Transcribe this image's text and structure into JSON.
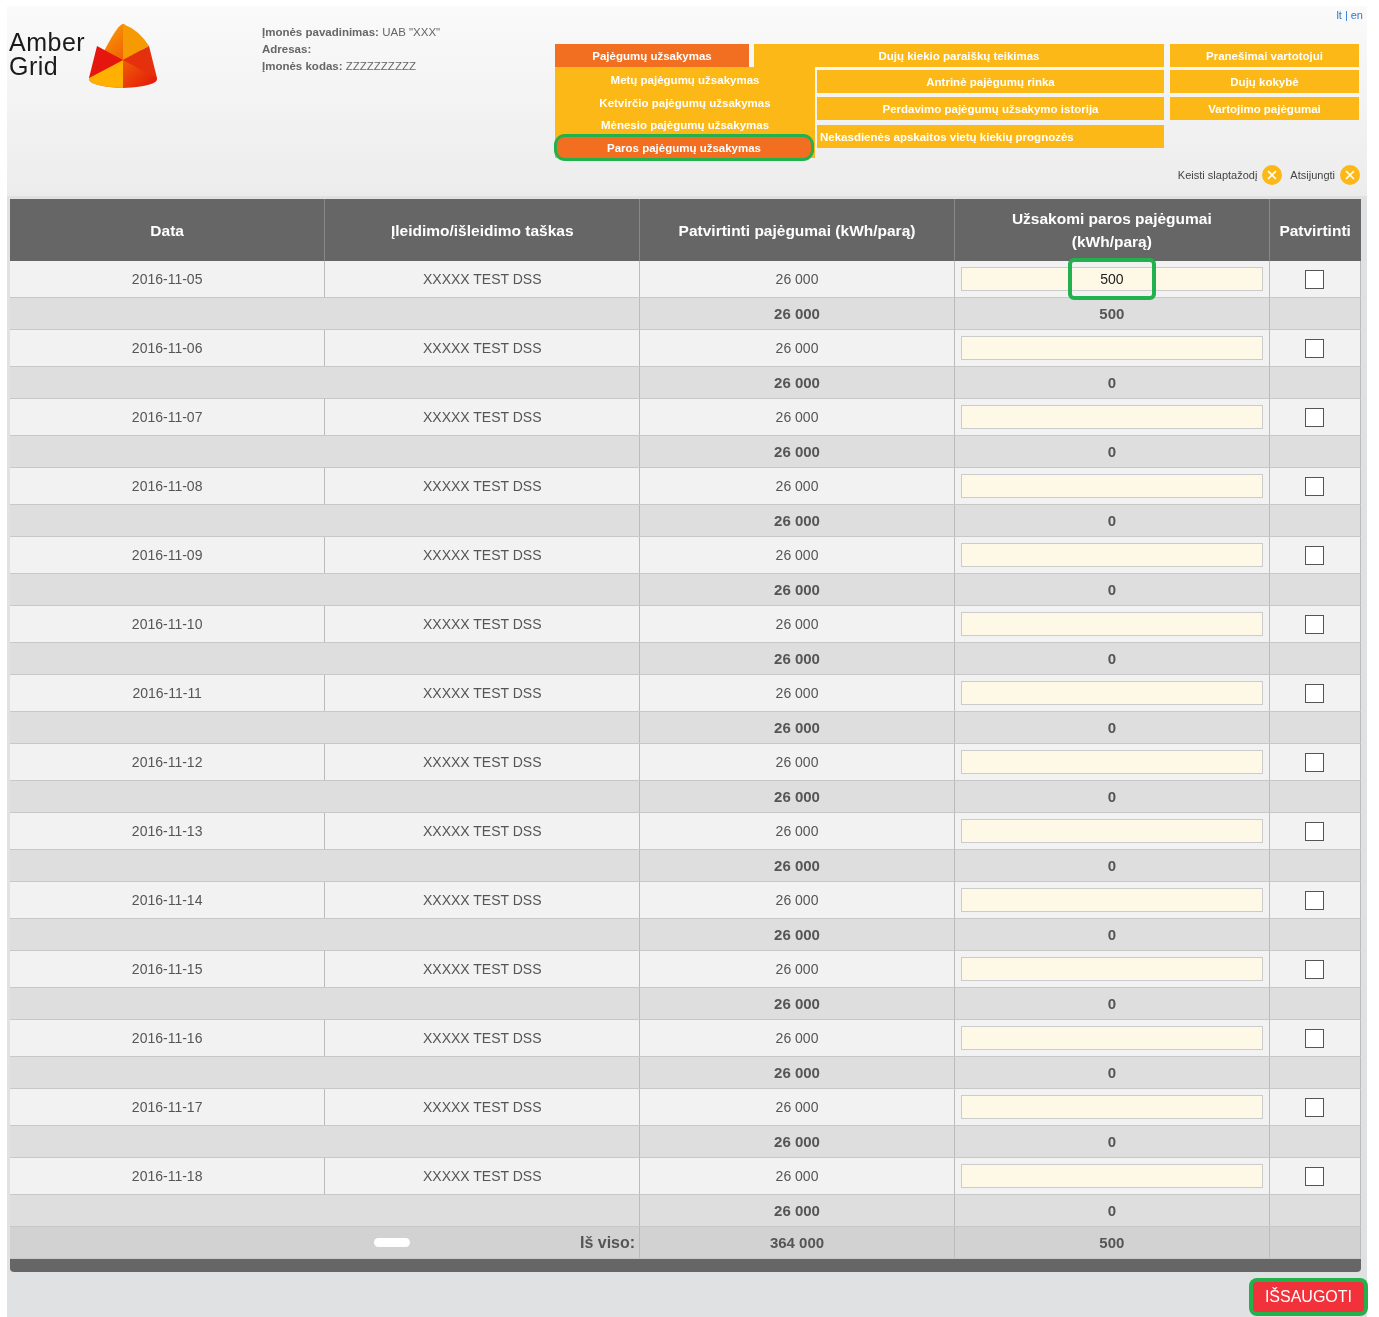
{
  "language_links": {
    "items": [
      "lt",
      "en"
    ],
    "separator": "|"
  },
  "logo": {
    "line_1": "Amber",
    "line_2": "Grid"
  },
  "company": [
    {
      "label": "Įmonės pavadinimas:",
      "value": "UAB \"XXX\""
    },
    {
      "label": "Adresas:"
    },
    {
      "label": "Įmonės kodas:",
      "value": "ZZZZZZZZZZ"
    }
  ],
  "menu": {
    "main": {
      "label": "Pajėgumų užsakymas",
      "selected": true,
      "children": [
        {
          "label": "Metų pajėgumų užsakymas",
          "selected": false,
          "highlighted": false
        },
        {
          "label": "Ketvirčio pajėgumų užsakymas",
          "selected": false,
          "highlighted": false
        },
        {
          "label": "Mėnesio pajėgumų užsakymas",
          "selected": false,
          "highlighted": false
        },
        {
          "label": "Paros pajėgumų užsakymas",
          "selected": true,
          "highlighted": true
        }
      ]
    },
    "column_2": [
      {
        "label": "Dujų kiekio paraiškų teikimas",
        "selected": false
      },
      {
        "label": "Antrinė pajėgumų rinka",
        "selected": false
      },
      {
        "label": "Perdavimo pajėgumų užsakymo istorija",
        "selected": false
      },
      {
        "label": "Nekasdienės apskaitos vietų kiekių prognozės",
        "selected": false
      }
    ],
    "column_3": [
      {
        "label": "Pranešimai vartotojui",
        "selected": false
      },
      {
        "label": "Dujų kokybė",
        "selected": false
      },
      {
        "label": "Vartojimo pajėgumai",
        "selected": false
      }
    ]
  },
  "user_links": [
    {
      "label": "Keisti slaptažodį"
    },
    {
      "label": "Atsijungti"
    }
  ],
  "table": {
    "columns": [
      "Data",
      "Įleidimo/išleidimo taškas",
      "Patvirtinti pajėgumai (kWh/parą)",
      "Užsakomi paros pajėgumai (kWh/parą)",
      "Patvirtinti"
    ],
    "rows": [
      {
        "date": "2016-11-05",
        "point": "XXXXX TEST DSS",
        "confirmed": "26 000",
        "order_value": "500",
        "highlighted": true,
        "checked": false,
        "subtotal_confirmed": "26 000",
        "subtotal_ordered": "500"
      },
      {
        "date": "2016-11-06",
        "point": "XXXXX TEST DSS",
        "confirmed": "26 000",
        "highlighted": false,
        "checked": false,
        "subtotal_confirmed": "26 000",
        "subtotal_ordered": "0"
      },
      {
        "date": "2016-11-07",
        "point": "XXXXX TEST DSS",
        "confirmed": "26 000",
        "highlighted": false,
        "checked": false,
        "subtotal_confirmed": "26 000",
        "subtotal_ordered": "0"
      },
      {
        "date": "2016-11-08",
        "point": "XXXXX TEST DSS",
        "confirmed": "26 000",
        "highlighted": false,
        "checked": false,
        "subtotal_confirmed": "26 000",
        "subtotal_ordered": "0"
      },
      {
        "date": "2016-11-09",
        "point": "XXXXX TEST DSS",
        "confirmed": "26 000",
        "highlighted": false,
        "checked": false,
        "subtotal_confirmed": "26 000",
        "subtotal_ordered": "0"
      },
      {
        "date": "2016-11-10",
        "point": "XXXXX TEST DSS",
        "confirmed": "26 000",
        "highlighted": false,
        "checked": false,
        "subtotal_confirmed": "26 000",
        "subtotal_ordered": "0"
      },
      {
        "date": "2016-11-11",
        "point": "XXXXX TEST DSS",
        "confirmed": "26 000",
        "highlighted": false,
        "checked": false,
        "subtotal_confirmed": "26 000",
        "subtotal_ordered": "0"
      },
      {
        "date": "2016-11-12",
        "point": "XXXXX TEST DSS",
        "confirmed": "26 000",
        "highlighted": false,
        "checked": false,
        "subtotal_confirmed": "26 000",
        "subtotal_ordered": "0"
      },
      {
        "date": "2016-11-13",
        "point": "XXXXX TEST DSS",
        "confirmed": "26 000",
        "highlighted": false,
        "checked": false,
        "subtotal_confirmed": "26 000",
        "subtotal_ordered": "0"
      },
      {
        "date": "2016-11-14",
        "point": "XXXXX TEST DSS",
        "confirmed": "26 000",
        "highlighted": false,
        "checked": false,
        "subtotal_confirmed": "26 000",
        "subtotal_ordered": "0"
      },
      {
        "date": "2016-11-15",
        "point": "XXXXX TEST DSS",
        "confirmed": "26 000",
        "highlighted": false,
        "checked": false,
        "subtotal_confirmed": "26 000",
        "subtotal_ordered": "0"
      },
      {
        "date": "2016-11-16",
        "point": "XXXXX TEST DSS",
        "confirmed": "26 000",
        "highlighted": false,
        "checked": false,
        "subtotal_confirmed": "26 000",
        "subtotal_ordered": "0"
      },
      {
        "date": "2016-11-17",
        "point": "XXXXX TEST DSS",
        "confirmed": "26 000",
        "highlighted": false,
        "checked": false,
        "subtotal_confirmed": "26 000",
        "subtotal_ordered": "0"
      },
      {
        "date": "2016-11-18",
        "point": "XXXXX TEST DSS",
        "confirmed": "26 000",
        "highlighted": false,
        "checked": false,
        "subtotal_confirmed": "26 000",
        "subtotal_ordered": "0"
      }
    ],
    "total": {
      "label": "Iš viso:",
      "confirmed": "364 000",
      "ordered": "500"
    }
  },
  "save_button": {
    "label": "IŠSAUGOTI",
    "highlighted": true
  }
}
